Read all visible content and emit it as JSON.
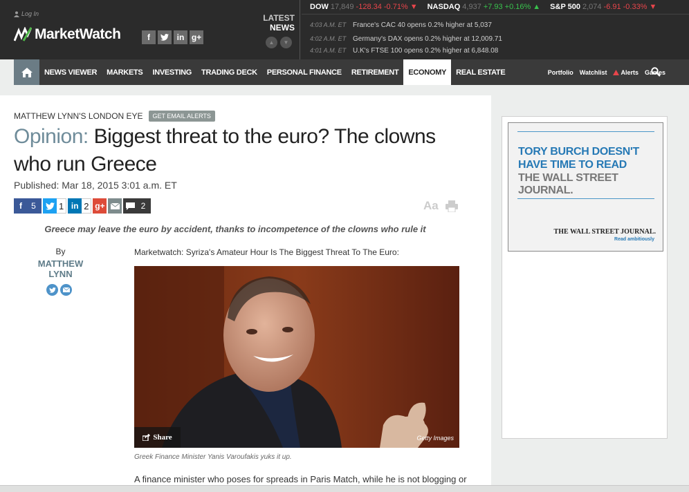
{
  "header": {
    "login_label": "Log In",
    "logo_text": "MarketWatch",
    "social_icons": [
      "facebook-icon",
      "twitter-icon",
      "linkedin-icon",
      "googleplus-icon"
    ],
    "latest_label_1": "LATEST",
    "latest_label_2": "NEWS",
    "tickers": [
      {
        "name": "DOW",
        "value": "17,849",
        "change": "-128.34",
        "pct": "-0.71%",
        "direction": "down"
      },
      {
        "name": "NASDAQ",
        "value": "4,937",
        "change": "+7.93",
        "pct": "+0.16%",
        "direction": "up"
      },
      {
        "name": "S&P 500",
        "value": "2,074",
        "change": "-6.91",
        "pct": "-0.33%",
        "direction": "down"
      }
    ],
    "news": [
      {
        "time": "4:03 A.M. ET",
        "text": "France's CAC 40 opens 0.2% higher at 5,037"
      },
      {
        "time": "4:02 A.M. ET",
        "text": "Germany's DAX opens 0.2% higher at 12,009.71"
      },
      {
        "time": "4:01 A.M. ET",
        "text": "U.K's FTSE 100 opens 0.2% higher at 6,848.08"
      }
    ]
  },
  "nav": {
    "items": [
      "NEWS VIEWER",
      "MARKETS",
      "INVESTING",
      "TRADING DECK",
      "PERSONAL FINANCE",
      "RETIREMENT",
      "ECONOMY",
      "REAL ESTATE"
    ],
    "active": "ECONOMY",
    "right": [
      "Portfolio",
      "Watchlist",
      "Alerts",
      "Games"
    ]
  },
  "article": {
    "kicker": "MATTHEW LYNN'S LONDON EYE",
    "email_alerts": "GET EMAIL ALERTS",
    "headline_prefix": "Opinion:",
    "headline": "Biggest threat to the euro? The clowns who run Greece",
    "published": "Published: Mar 18, 2015 3:01 a.m. ET",
    "shares": {
      "facebook": "5",
      "twitter": "1",
      "linkedin": "2",
      "googleplus": "",
      "email": "",
      "comments": "2"
    },
    "text_size_label": "Aa",
    "subtitle": "Greece may leave the euro by accident, thanks to incompetence of the clowns who rule it",
    "by_label": "By",
    "author_first": "MATTHEW",
    "author_last": "LYNN",
    "source_line": "Marketwatch: Syriza's Amateur Hour Is The Biggest Threat To The Euro:",
    "photo_share_label": "Share",
    "photo_credit": "Getty Images",
    "caption": "Greek Finance Minister Yanis Varoufakis yuks it up.",
    "body_first_line": "A finance minister who poses for spreads in Paris Match, while he is not blogging or"
  },
  "ad": {
    "line1": "TORY BURCH DOESN'T",
    "line2": "HAVE TIME TO READ",
    "line3": "THE WALL STREET JOURNAL.",
    "brand": "THE WALL STREET JOURNAL.",
    "tagline": "Read ambitiously"
  },
  "colors": {
    "accent": "#6f8c9a",
    "header_bg": "#2b2b2b",
    "nav_bg": "#3a3a3a",
    "up": "#39c24d",
    "down": "#e8454b",
    "ad_blue": "#2679b5"
  }
}
